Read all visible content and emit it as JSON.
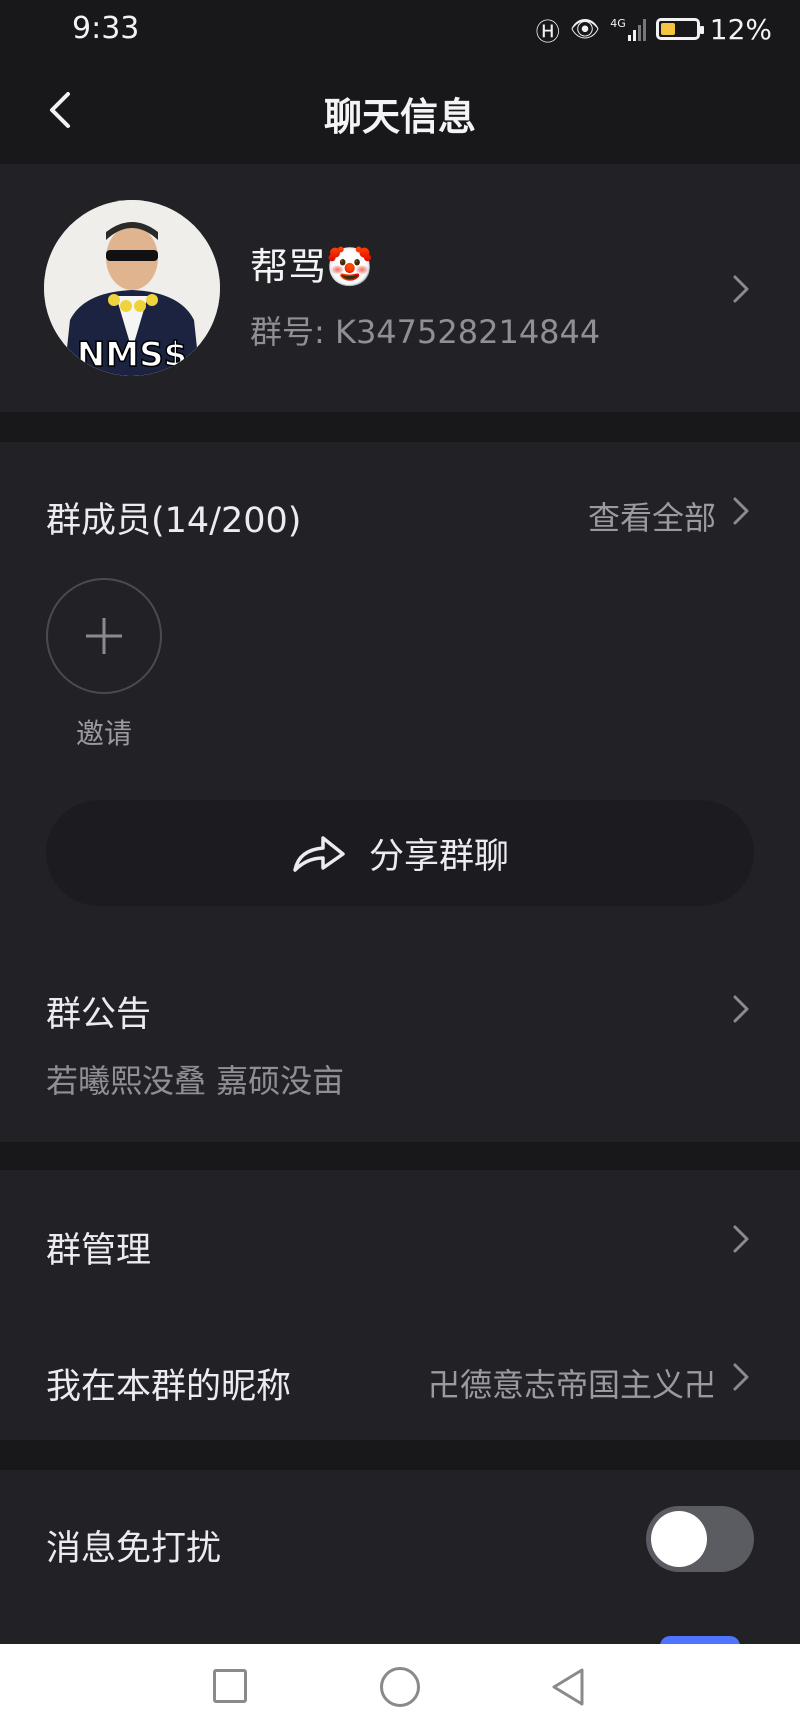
{
  "status_bar": {
    "time": "9:33",
    "network": "4G",
    "battery_percent": "12%",
    "battery_level": 0.12
  },
  "header": {
    "title": "聊天信息",
    "back_icon": "chevron-left-icon"
  },
  "group": {
    "name": "帮骂🤡",
    "number_label": "群号: K347528214844",
    "avatar_caption": "NMS$"
  },
  "members": {
    "title": "群成员(14/200)",
    "view_all": "查看全部",
    "invite_label": "邀请"
  },
  "share": {
    "label": "分享群聊",
    "icon": "share-icon"
  },
  "notice": {
    "title": "群公告",
    "text": "若曦熙没叠 嘉硕没亩"
  },
  "management": {
    "manage_label": "群管理",
    "nickname_label": "我在本群的昵称",
    "nickname_value": "卍德意志帝国主义卍"
  },
  "settings": {
    "dnd_label": "消息免打扰",
    "dnd_on": false
  },
  "colors": {
    "background": "#1e1e22",
    "card": "#222226",
    "accent": "#4f74ff",
    "muted_text": "#8f8f96"
  }
}
